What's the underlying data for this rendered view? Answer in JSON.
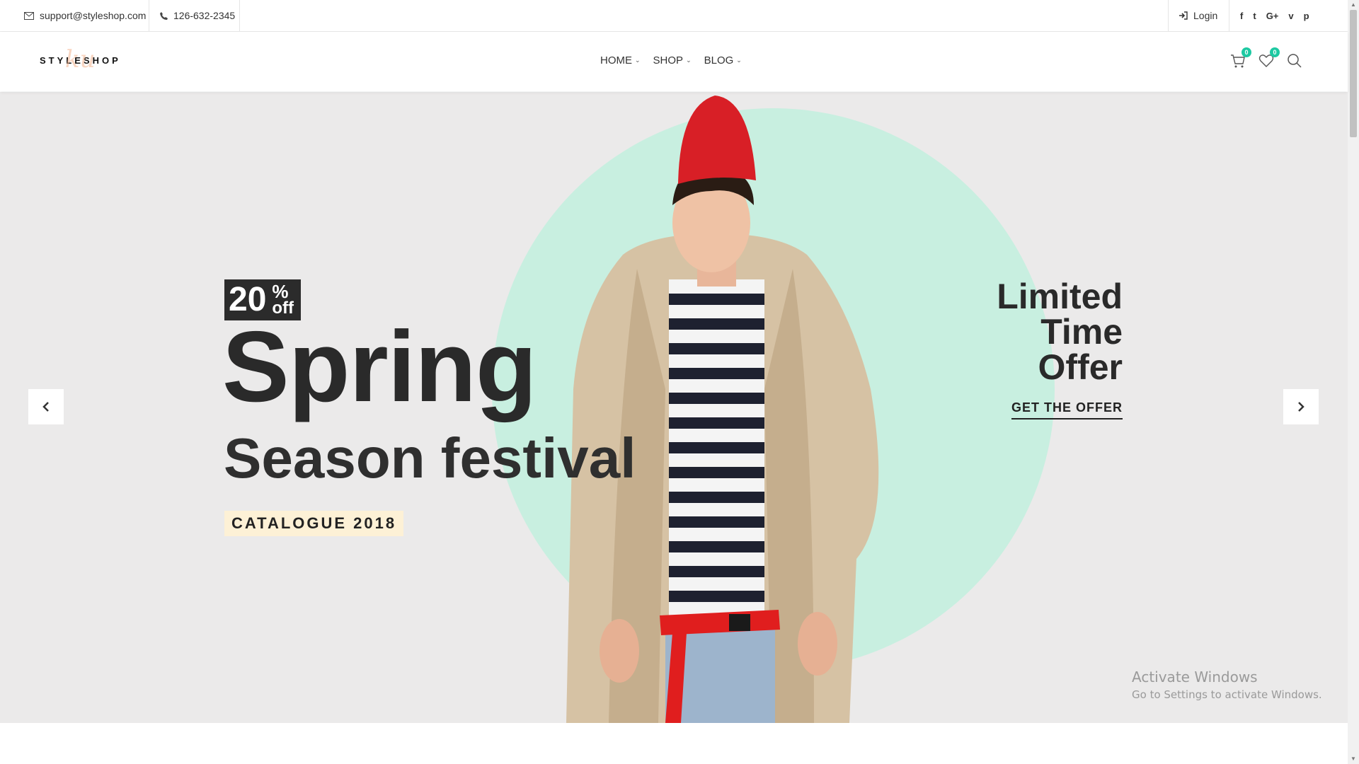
{
  "topbar": {
    "email": "support@styleshop.com",
    "phone": "126-632-2345",
    "login": "Login",
    "social": [
      {
        "icon": "facebook-icon",
        "glyph": "f"
      },
      {
        "icon": "twitter-icon",
        "glyph": "t"
      },
      {
        "icon": "google-plus-icon",
        "glyph": "G+"
      },
      {
        "icon": "vimeo-icon",
        "glyph": "v"
      },
      {
        "icon": "pinterest-icon",
        "glyph": "p"
      }
    ]
  },
  "header": {
    "logo": "STYLESHOP",
    "nav": [
      {
        "label": "HOME"
      },
      {
        "label": "SHOP"
      },
      {
        "label": "BLOG"
      }
    ],
    "cart_count": "0",
    "wishlist_count": "0"
  },
  "hero": {
    "discount_number": "20",
    "discount_percent": "%",
    "discount_off": "off",
    "headline": "Spring",
    "subheadline": "Season festival",
    "catalogue": "CATALOGUE 2018",
    "limited_line1": "Limited",
    "limited_line2": "Time",
    "limited_line3": "Offer",
    "cta": "GET THE OFFER",
    "circle_color": "#c8efe0"
  },
  "watermark": {
    "line1": "Activate Windows",
    "line2": "Go to Settings to activate Windows."
  }
}
